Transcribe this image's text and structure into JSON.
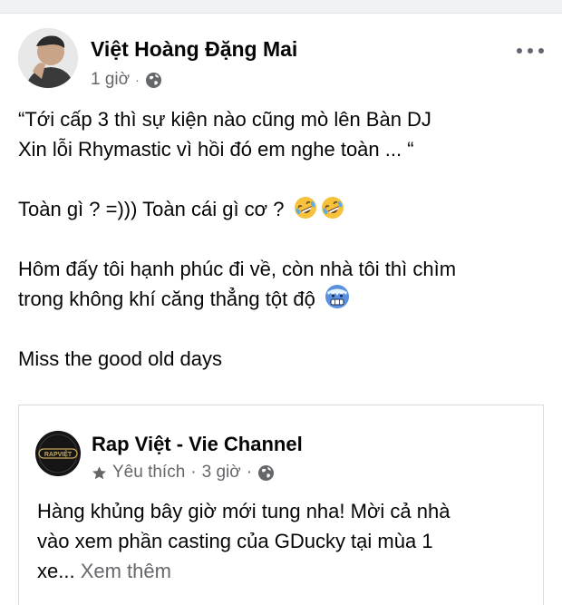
{
  "post": {
    "author": "Việt Hoàng Đặng Mai",
    "time": "1 giờ",
    "separator": "·",
    "body": [
      [
        "“Tới cấp 3 thì sự kiện nào cũng mò lên Bàn DJ",
        "Xin lỗi Rhymastic vì hồi đó em nghe toàn ... “"
      ],
      [
        "Toàn gì ? =))) Toàn cái gì cơ ?"
      ],
      [
        "Hôm đấy tôi hạnh phúc đi về, còn nhà tôi thì chìm",
        "trong không khí căng thẳng tột độ"
      ],
      [
        "Miss the good old days"
      ]
    ],
    "emojis": [
      "rofl-emoji",
      "rofl-emoji",
      "cold-face-emoji"
    ]
  },
  "shared_post": {
    "page_name": "Rap Việt - Vie Channel",
    "logo_text": "RAPVIỆT",
    "badge_label": "Yêu thích",
    "separator": "·",
    "time": "3 giờ",
    "text_line1": "Hàng khủng bây giờ mới tung nha! Mời cả nhà",
    "text_line2": "vào xem phần casting của GDucky tại mùa 1",
    "text_line3": "xe...",
    "see_more": "Xem thêm"
  },
  "colors": {
    "text": "#050505",
    "secondary": "#65676b",
    "border": "#d9dbdf"
  },
  "icons": [
    "globe-icon",
    "more-options-icon",
    "star-icon"
  ]
}
